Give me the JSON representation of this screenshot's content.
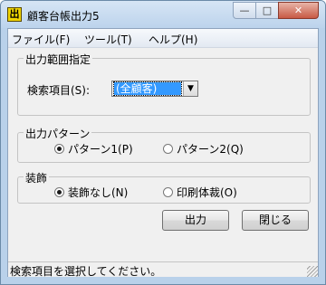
{
  "window": {
    "title": "顧客台帳出力5",
    "app_icon_glyph": "出",
    "minimize_glyph": "—",
    "maximize_glyph": "□",
    "close_glyph": "✕"
  },
  "menu": {
    "items": [
      {
        "label": "ファイル(F)"
      },
      {
        "label": "ツール(T)"
      },
      {
        "label": "ヘルプ(H)"
      }
    ]
  },
  "range_group": {
    "title": "出力範囲指定",
    "search_label": "検索項目(S):",
    "search_value": "(全顧客)",
    "dropdown_glyph": "▼"
  },
  "pattern_group": {
    "title": "出力パターン",
    "options": [
      {
        "label": "パターン1(P)",
        "checked": true
      },
      {
        "label": "パターン2(Q)",
        "checked": false
      }
    ]
  },
  "decoration_group": {
    "title": "装飾",
    "options": [
      {
        "label": "装飾なし(N)",
        "checked": true
      },
      {
        "label": "印刷体裁(O)",
        "checked": false
      }
    ]
  },
  "buttons": {
    "output_label": "出力",
    "close_label": "閉じる"
  },
  "status": {
    "text": "検索項目を選択してください。"
  }
}
